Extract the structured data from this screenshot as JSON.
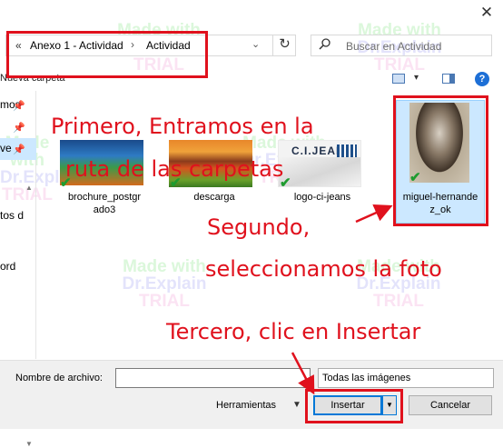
{
  "window": {
    "close_glyph": "✕"
  },
  "address": {
    "back_glyph": "«",
    "segments": [
      "Anexo 1 - Actividad",
      "Actividad"
    ],
    "separator": "›",
    "dropdown_glyph": "⌄",
    "refresh_glyph": "↻"
  },
  "search": {
    "placeholder": "Buscar en Actividad",
    "icon": "search-icon"
  },
  "toolbar": {
    "new_folder": "Nueva carpeta",
    "view_dropdown": "▾",
    "help": "?"
  },
  "sidebar": {
    "items": [
      {
        "label": "mos",
        "pinned": true
      },
      {
        "label": "",
        "pinned": true
      },
      {
        "label": "ve",
        "pinned": true,
        "selected": true
      },
      {
        "label": "tos d",
        "pinned": false
      },
      {
        "label": "ord",
        "pinned": false
      }
    ],
    "scroll_up": "▲",
    "scroll_down": "▼"
  },
  "files": [
    {
      "name_line1": "brochure_postgr",
      "name_line2": "ado3",
      "synced": true
    },
    {
      "name_line1": "descarga",
      "name_line2": "",
      "synced": true
    },
    {
      "name_line1": "logo-ci-jeans",
      "name_line2": "",
      "synced": true,
      "logo_text": "C.I.JEANS"
    },
    {
      "name_line1": "miguel-hernande",
      "name_line2": "z_ok",
      "synced": true,
      "selected": true
    }
  ],
  "check_glyph": "✔",
  "bottom": {
    "filename_label": "Nombre de archivo:",
    "filename_value": "",
    "filter_label": "Todas las imágenes",
    "tools_label": "Herramientas",
    "tools_dd": "▼",
    "insert_label": "Insertar",
    "insert_dd": "▼",
    "cancel_label": "Cancelar"
  },
  "watermark": {
    "line1": "Made with",
    "line2": "Dr.Explain",
    "line3": "TRIAL"
  },
  "annotations": {
    "step1_line1": "Primero, Entramos en la",
    "step1_line2": "ruta de las carpetas",
    "step2_line1": "Segundo,",
    "step2_line2": "seleccionamos la foto",
    "step3": "Tercero, clic en Insertar"
  },
  "colors": {
    "annotation_red": "#e0111d",
    "selection_blue": "#cce8ff",
    "accent_blue": "#0078d7"
  }
}
